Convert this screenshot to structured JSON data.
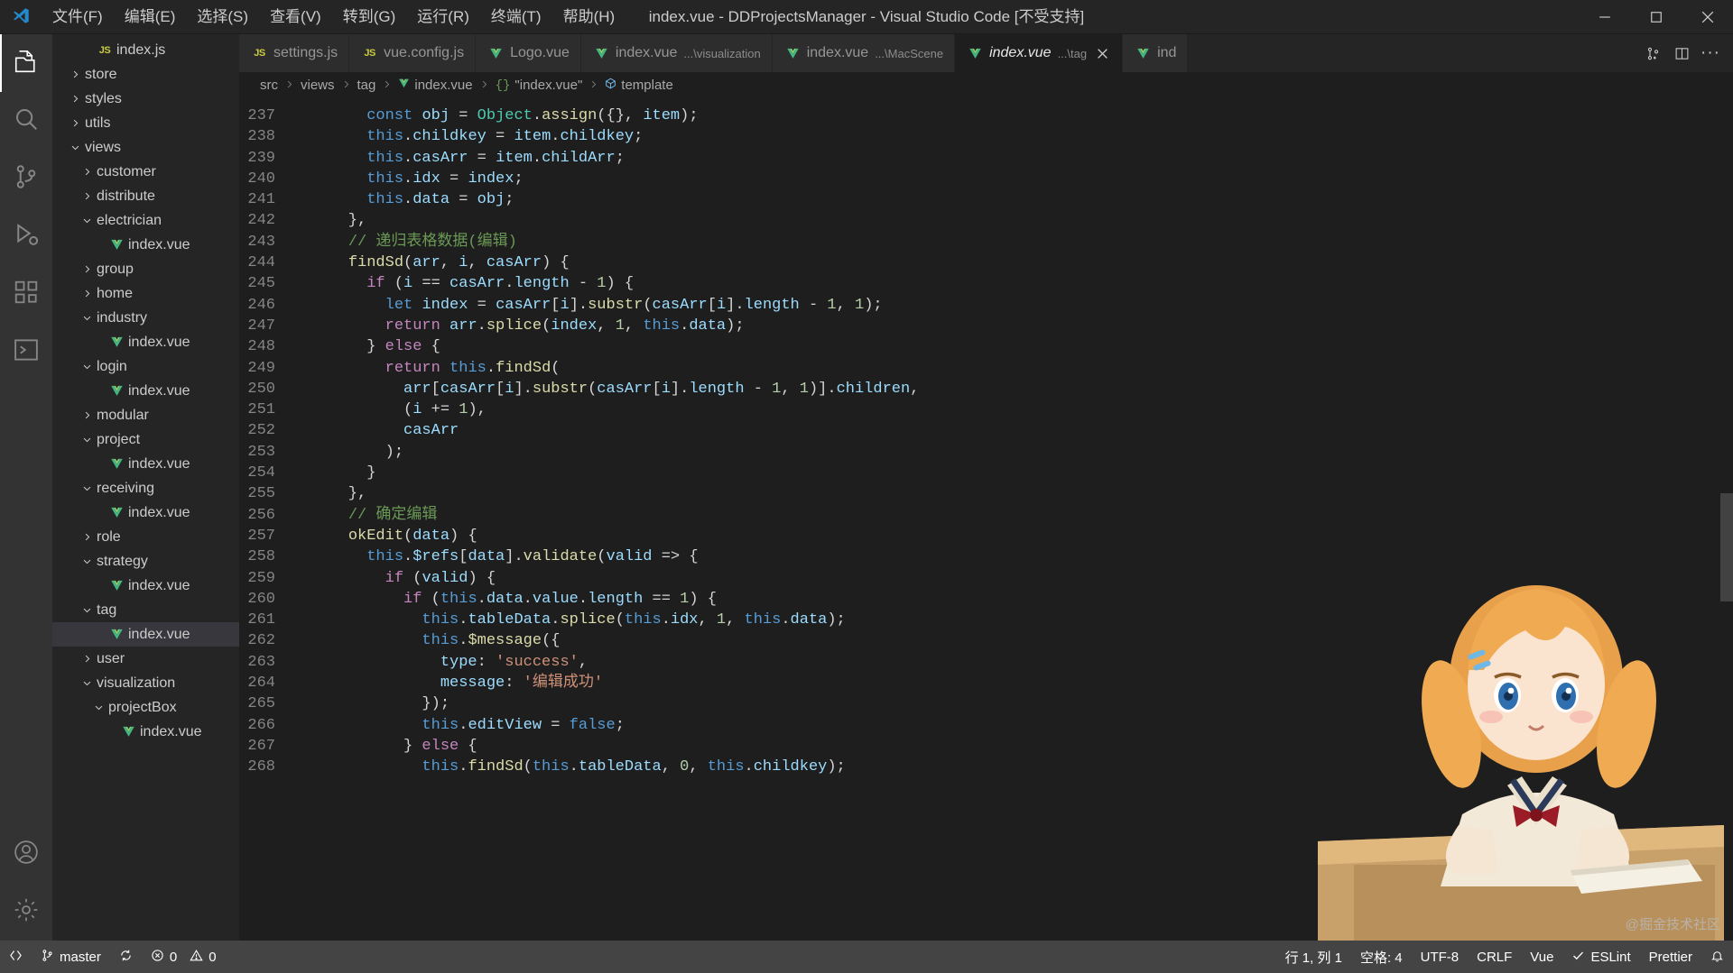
{
  "titlebar": {
    "logo_icon": "vscode-logo-icon",
    "menus": [
      {
        "label": "文件(F)",
        "name": "menu-file"
      },
      {
        "label": "编辑(E)",
        "name": "menu-edit"
      },
      {
        "label": "选择(S)",
        "name": "menu-selection"
      },
      {
        "label": "查看(V)",
        "name": "menu-view"
      },
      {
        "label": "转到(G)",
        "name": "menu-go"
      },
      {
        "label": "运行(R)",
        "name": "menu-run"
      },
      {
        "label": "终端(T)",
        "name": "menu-terminal"
      },
      {
        "label": "帮助(H)",
        "name": "menu-help"
      }
    ],
    "window_title": "index.vue - DDProjectsManager - Visual Studio Code [不受支持]",
    "controls": [
      "minimize-icon",
      "maximize-icon",
      "close-icon"
    ]
  },
  "activitybar": {
    "items": [
      {
        "name": "explorer",
        "icon": "files-icon",
        "active": true
      },
      {
        "name": "search",
        "icon": "search-icon",
        "active": false
      },
      {
        "name": "source-control",
        "icon": "source-control-icon",
        "active": false
      },
      {
        "name": "run-and-debug",
        "icon": "debug-icon",
        "active": false
      },
      {
        "name": "extensions",
        "icon": "extensions-icon",
        "active": false
      },
      {
        "name": "remote-explorer",
        "icon": "remote-icon",
        "active": false
      }
    ],
    "bottom_items": [
      {
        "name": "accounts",
        "icon": "account-icon"
      },
      {
        "name": "manage",
        "icon": "gear-icon"
      }
    ]
  },
  "explorer": {
    "toolbar": [
      {
        "name": "new-file",
        "icon": "new-file-icon"
      },
      {
        "name": "new-folder",
        "icon": "new-folder-icon"
      },
      {
        "name": "refresh-explorer",
        "icon": "refresh-icon"
      },
      {
        "name": "collapse-folders",
        "icon": "collapse-all-icon"
      },
      {
        "name": "explorer-more",
        "icon": "ellipsis-icon"
      }
    ],
    "tree": [
      {
        "label": "index.js",
        "indent": 2,
        "type": "file",
        "icon": "js-file-icon",
        "state": "none"
      },
      {
        "label": "store",
        "indent": 1,
        "type": "folder",
        "icon": "folder-icon",
        "state": "collapsed"
      },
      {
        "label": "styles",
        "indent": 1,
        "type": "folder",
        "icon": "folder-icon",
        "state": "collapsed"
      },
      {
        "label": "utils",
        "indent": 1,
        "type": "folder",
        "icon": "folder-icon",
        "state": "collapsed"
      },
      {
        "label": "views",
        "indent": 1,
        "type": "folder",
        "icon": "folder-icon",
        "state": "expanded"
      },
      {
        "label": "customer",
        "indent": 2,
        "type": "folder",
        "icon": "folder-icon",
        "state": "collapsed"
      },
      {
        "label": "distribute",
        "indent": 2,
        "type": "folder",
        "icon": "folder-icon",
        "state": "collapsed"
      },
      {
        "label": "electrician",
        "indent": 2,
        "type": "folder",
        "icon": "folder-icon",
        "state": "expanded"
      },
      {
        "label": "index.vue",
        "indent": 3,
        "type": "file",
        "icon": "vue-file-icon",
        "state": "none"
      },
      {
        "label": "group",
        "indent": 2,
        "type": "folder",
        "icon": "folder-icon",
        "state": "collapsed"
      },
      {
        "label": "home",
        "indent": 2,
        "type": "folder",
        "icon": "folder-icon",
        "state": "collapsed"
      },
      {
        "label": "industry",
        "indent": 2,
        "type": "folder",
        "icon": "folder-icon",
        "state": "expanded"
      },
      {
        "label": "index.vue",
        "indent": 3,
        "type": "file",
        "icon": "vue-file-icon",
        "state": "none"
      },
      {
        "label": "login",
        "indent": 2,
        "type": "folder",
        "icon": "folder-icon",
        "state": "expanded"
      },
      {
        "label": "index.vue",
        "indent": 3,
        "type": "file",
        "icon": "vue-file-icon",
        "state": "none"
      },
      {
        "label": "modular",
        "indent": 2,
        "type": "folder",
        "icon": "folder-icon",
        "state": "collapsed"
      },
      {
        "label": "project",
        "indent": 2,
        "type": "folder",
        "icon": "folder-icon",
        "state": "expanded"
      },
      {
        "label": "index.vue",
        "indent": 3,
        "type": "file",
        "icon": "vue-file-icon",
        "state": "none"
      },
      {
        "label": "receiving",
        "indent": 2,
        "type": "folder",
        "icon": "folder-icon",
        "state": "expanded"
      },
      {
        "label": "index.vue",
        "indent": 3,
        "type": "file",
        "icon": "vue-file-icon",
        "state": "none"
      },
      {
        "label": "role",
        "indent": 2,
        "type": "folder",
        "icon": "folder-icon",
        "state": "collapsed"
      },
      {
        "label": "strategy",
        "indent": 2,
        "type": "folder",
        "icon": "folder-icon",
        "state": "expanded"
      },
      {
        "label": "index.vue",
        "indent": 3,
        "type": "file",
        "icon": "vue-file-icon",
        "state": "none"
      },
      {
        "label": "tag",
        "indent": 2,
        "type": "folder",
        "icon": "folder-icon",
        "state": "expanded"
      },
      {
        "label": "index.vue",
        "indent": 3,
        "type": "file",
        "icon": "vue-file-icon",
        "state": "none",
        "selected": true
      },
      {
        "label": "user",
        "indent": 2,
        "type": "folder",
        "icon": "folder-icon",
        "state": "collapsed"
      },
      {
        "label": "visualization",
        "indent": 2,
        "type": "folder",
        "icon": "folder-icon",
        "state": "expanded"
      },
      {
        "label": "projectBox",
        "indent": 3,
        "type": "folder",
        "icon": "folder-icon",
        "state": "expanded"
      },
      {
        "label": "index.vue",
        "indent": 4,
        "type": "file",
        "icon": "vue-file-icon",
        "state": "none"
      }
    ]
  },
  "tabs": [
    {
      "name": "settings.js",
      "desc": "",
      "icon": "js-file-icon",
      "active": false
    },
    {
      "name": "vue.config.js",
      "desc": "",
      "icon": "js-file-icon",
      "active": false
    },
    {
      "name": "Logo.vue",
      "desc": "",
      "icon": "vue-file-icon",
      "active": false
    },
    {
      "name": "index.vue",
      "desc": "...\\visualization",
      "icon": "vue-file-icon",
      "active": false
    },
    {
      "name": "index.vue",
      "desc": "...\\MacScene",
      "icon": "vue-file-icon",
      "active": false
    },
    {
      "name": "index.vue",
      "desc": "...\\tag",
      "icon": "vue-file-icon",
      "active": true
    },
    {
      "name": "ind",
      "desc": "",
      "icon": "vue-file-icon",
      "active": false
    }
  ],
  "tab_actions": [
    {
      "name": "split-editor-compare",
      "icon": "compare-icon"
    },
    {
      "name": "split-editor-right",
      "icon": "split-editor-icon"
    },
    {
      "name": "editor-more-actions",
      "icon": "ellipsis-icon"
    }
  ],
  "breadcrumbs": [
    {
      "label": "src",
      "icon": ""
    },
    {
      "label": "views",
      "icon": ""
    },
    {
      "label": "tag",
      "icon": ""
    },
    {
      "label": "index.vue",
      "icon": "vue-file-icon"
    },
    {
      "label": "\"index.vue\"",
      "icon": "braces-icon"
    },
    {
      "label": "template",
      "icon": "symbol-module-icon"
    }
  ],
  "editor": {
    "first_line": 237,
    "line_numbers": [
      237,
      238,
      239,
      240,
      241,
      242,
      243,
      244,
      245,
      246,
      247,
      248,
      249,
      250,
      251,
      252,
      253,
      254,
      255,
      256,
      257,
      258,
      259,
      260,
      261,
      262,
      263,
      264,
      265,
      266,
      267,
      268
    ],
    "code_lines": [
      "      const obj = Object.assign({}, item);",
      "      this.childkey = item.childkey;",
      "      this.casArr = item.childArr;",
      "      this.idx = index;",
      "      this.data = obj;",
      "    },",
      "    // 递归表格数据(编辑)",
      "    findSd(arr, i, casArr) {",
      "      if (i == casArr.length - 1) {",
      "        let index = casArr[i].substr(casArr[i].length - 1, 1);",
      "        return arr.splice(index, 1, this.data);",
      "      } else {",
      "        return this.findSd(",
      "          arr[casArr[i].substr(casArr[i].length - 1, 1)].children,",
      "          (i += 1),",
      "          casArr",
      "        );",
      "      }",
      "    },",
      "    // 确定编辑",
      "    okEdit(data) {",
      "      this.$refs[data].validate(valid => {",
      "        if (valid) {",
      "          if (this.data.value.length == 1) {",
      "            this.tableData.splice(this.idx, 1, this.data);",
      "            this.$message({",
      "              type: 'success',",
      "              message: '编辑成功'",
      "            });",
      "            this.editView = false;",
      "          } else {",
      "            this.findSd(this.tableData, 0, this.childkey);"
    ]
  },
  "mascot": {
    "credit": "@掘金技术社区"
  },
  "statusbar": {
    "left": [
      {
        "name": "remote-indicator",
        "icon": "remote-icon",
        "label": ""
      },
      {
        "name": "git-branch",
        "icon": "source-control-icon",
        "label": "master"
      },
      {
        "name": "sync-changes",
        "icon": "sync-icon",
        "label": ""
      },
      {
        "name": "problems-errors",
        "icon": "error-icon",
        "label": "0"
      },
      {
        "name": "problems-warnings",
        "icon": "warning-icon",
        "label": "0"
      }
    ],
    "right": [
      {
        "name": "cursor-position",
        "label": "行 1, 列 1"
      },
      {
        "name": "indentation",
        "label": "空格: 4"
      },
      {
        "name": "encoding",
        "label": "UTF-8"
      },
      {
        "name": "eol",
        "label": "CRLF"
      },
      {
        "name": "language-mode",
        "label": "Vue"
      },
      {
        "name": "eslint-status",
        "label": "ESLint",
        "icon": "check-icon"
      },
      {
        "name": "prettier-status",
        "label": "Prettier"
      },
      {
        "name": "notifications",
        "label": "",
        "icon": "bell-icon"
      }
    ]
  },
  "colors": {
    "titlebar_bg": "#252526",
    "activitybar_bg": "#333333",
    "sidebar_bg": "#252526",
    "editor_bg": "#1e1e1e",
    "statusbar_bg": "#444444",
    "accent_vue_green": "#41b883",
    "tab_active_bg": "#1e1e1e",
    "tab_inactive_bg": "#2d2d2d"
  }
}
